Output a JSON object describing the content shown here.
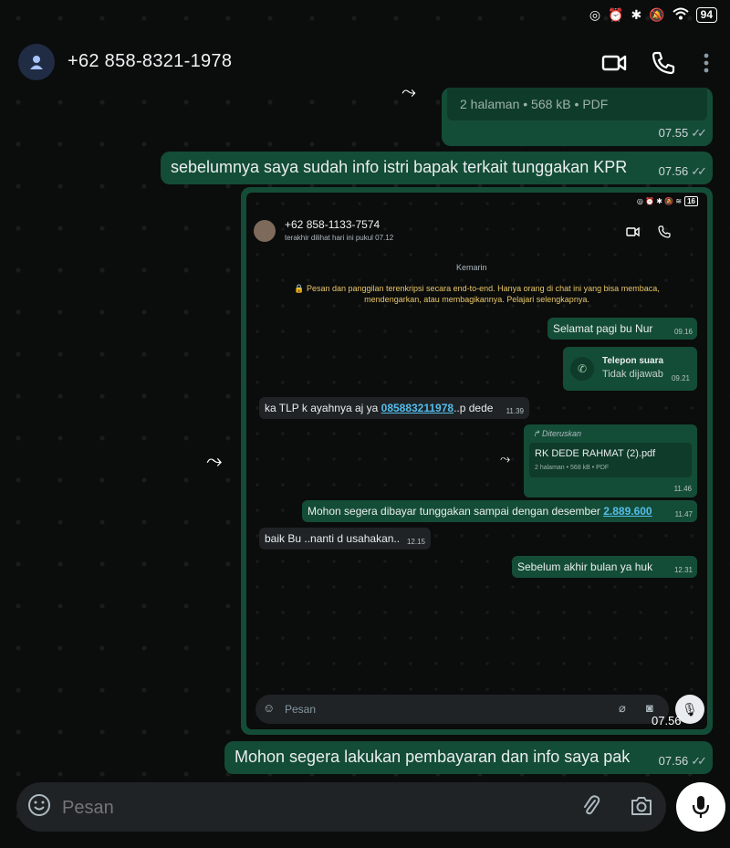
{
  "status_bar": {
    "battery": "94"
  },
  "header": {
    "contact": "+62 858-8321-1978"
  },
  "messages": {
    "pdf_cut": {
      "info": "2 halaman  •  568 kB  •  PDF",
      "time": "07.55"
    },
    "msg1": {
      "text": "sebelumnya saya sudah info istri bapak terkait tunggakan KPR",
      "time": "07.56"
    },
    "shot_time": "07.56",
    "msg2": {
      "text": "Mohon segera lakukan pembayaran dan info saya pak",
      "time": "07.56"
    }
  },
  "screenshot": {
    "battery": "16",
    "contact": "+62 858-1133-7574",
    "last_seen": "terakhir dilihat hari ini pukul 07.12",
    "date_chip": "Kemarin",
    "encryption": "🔒 Pesan dan panggilan terenkripsi secara end-to-end. Hanya orang di chat ini yang bisa membaca, mendengarkan, atau membagikannya. Pelajari selengkapnya.",
    "m1": {
      "text": "Selamat pagi bu Nur",
      "time": "09.16"
    },
    "call": {
      "title": "Telepon suara",
      "sub": "Tidak dijawab",
      "time": "09.21"
    },
    "m2": {
      "pre": "ka TLP k ayahnya aj ya ",
      "link": "085883211978",
      "post": "..p dede",
      "time": "11.39"
    },
    "fwd": {
      "label": "Diteruskan",
      "file": "RK DEDE RAHMAT (2).pdf",
      "info": "2 halaman  •  568 kB  •  PDF",
      "time": "11.46"
    },
    "m3": {
      "pre": "Mohon segera dibayar tunggakan sampai dengan desember ",
      "link": "2.889.600",
      "time": "11.47"
    },
    "m4": {
      "text": "baik Bu ..nanti d usahakan..",
      "time": "12.15"
    },
    "m5": {
      "text": "Sebelum akhir bulan ya huk",
      "time": "12.31"
    },
    "placeholder": "Pesan"
  },
  "input": {
    "placeholder": "Pesan"
  },
  "colors": {
    "bubble_out": "#144d37",
    "link": "#53bdeb",
    "bg": "#0b0c0c"
  }
}
